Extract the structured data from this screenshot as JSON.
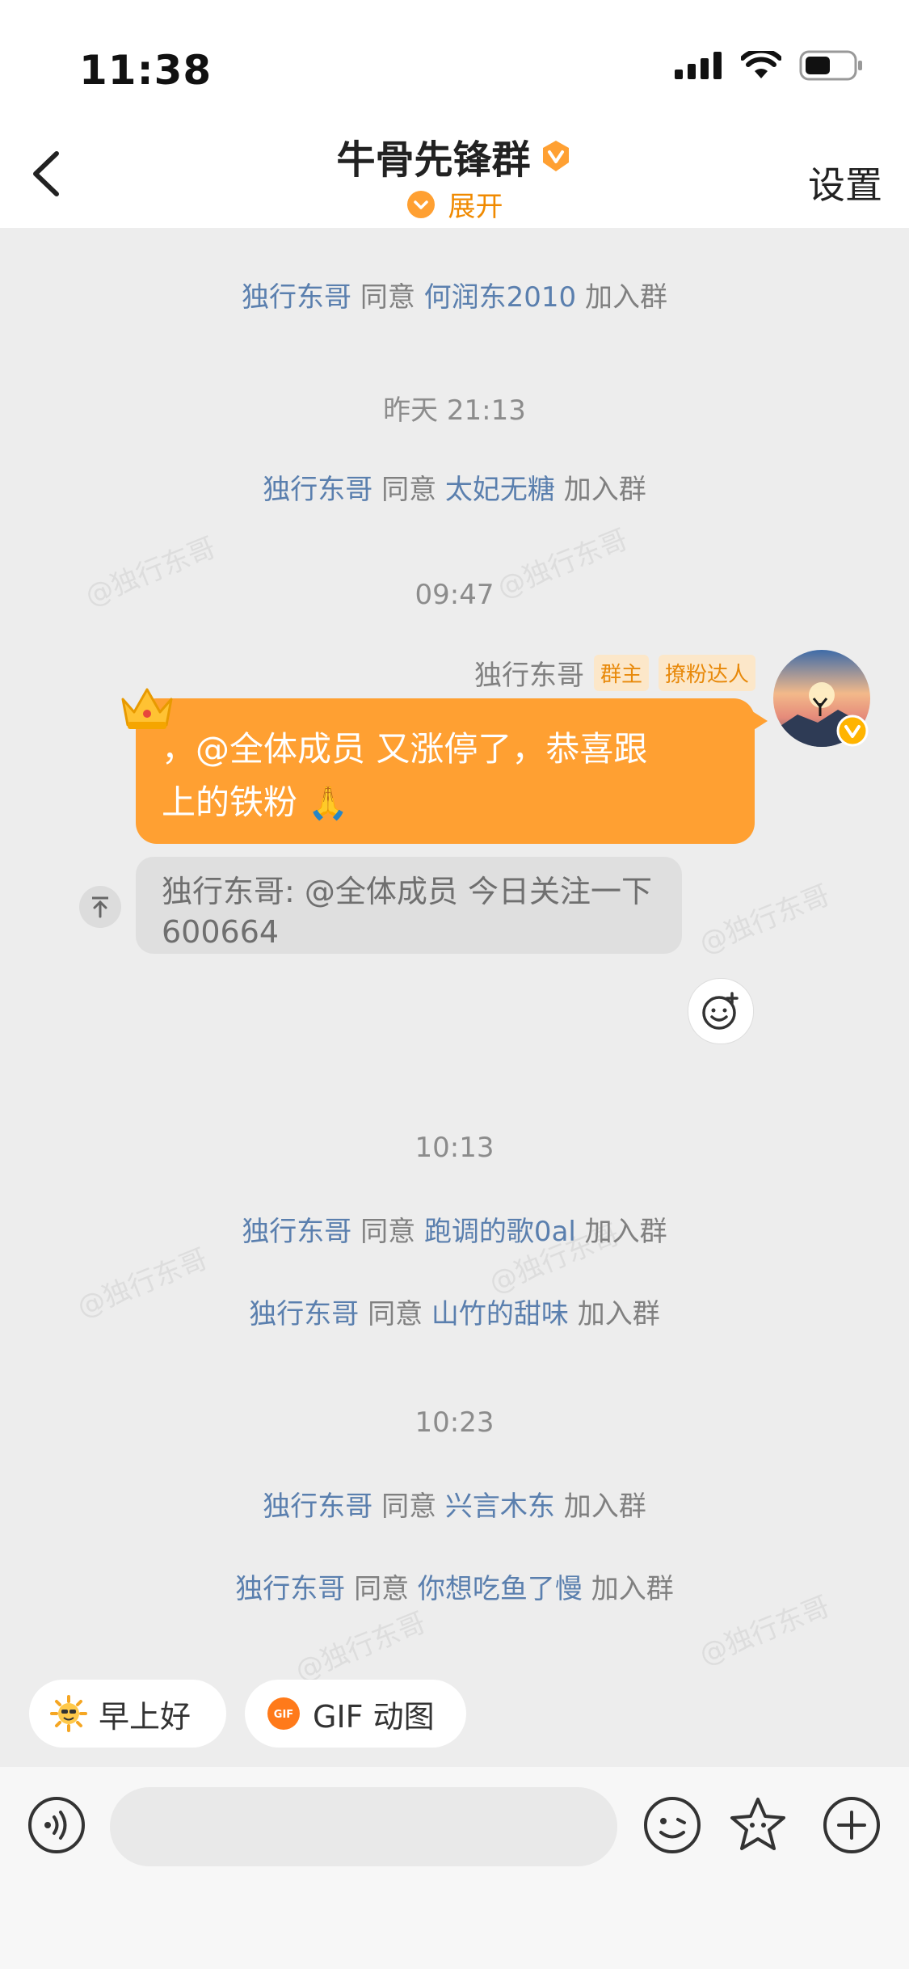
{
  "status_bar": {
    "time": "11:38"
  },
  "header": {
    "title": "牛骨先锋群",
    "subtitle": "展开",
    "settings_label": "设置"
  },
  "system_messages": [
    {
      "actor": "独行东哥",
      "verb": "同意",
      "member": "何润东2010",
      "suffix": "加入群"
    },
    {
      "actor": "独行东哥",
      "verb": "同意",
      "member": "太妃无糖",
      "suffix": "加入群"
    },
    {
      "actor": "独行东哥",
      "verb": "同意",
      "member": "跑调的歌0al",
      "suffix": "加入群"
    },
    {
      "actor": "独行东哥",
      "verb": "同意",
      "member": "山竹的甜味",
      "suffix": "加入群"
    },
    {
      "actor": "独行东哥",
      "verb": "同意",
      "member": "兴言木东",
      "suffix": "加入群"
    },
    {
      "actor": "独行东哥",
      "verb": "同意",
      "member": "你想吃鱼了慢",
      "suffix": "加入群"
    }
  ],
  "timestamps": [
    "昨天 21:13",
    "09:47",
    "10:13",
    "10:23"
  ],
  "message": {
    "sender": "独行东哥",
    "tags": [
      "群主",
      "撩粉达人"
    ],
    "text_line1": "，@全体成员 又涨停了，恭喜跟",
    "text_line2": "上的铁粉",
    "quote_line1": "独行东哥: @全体成员 今日关注一下",
    "quote_line2": "600664"
  },
  "watermark_text": "@独行东哥",
  "quick_replies": [
    "早上好",
    "GIF 动图"
  ],
  "colors": {
    "accent": "#FFA032",
    "link": "#5A7FAE",
    "background": "#EDEDED"
  }
}
